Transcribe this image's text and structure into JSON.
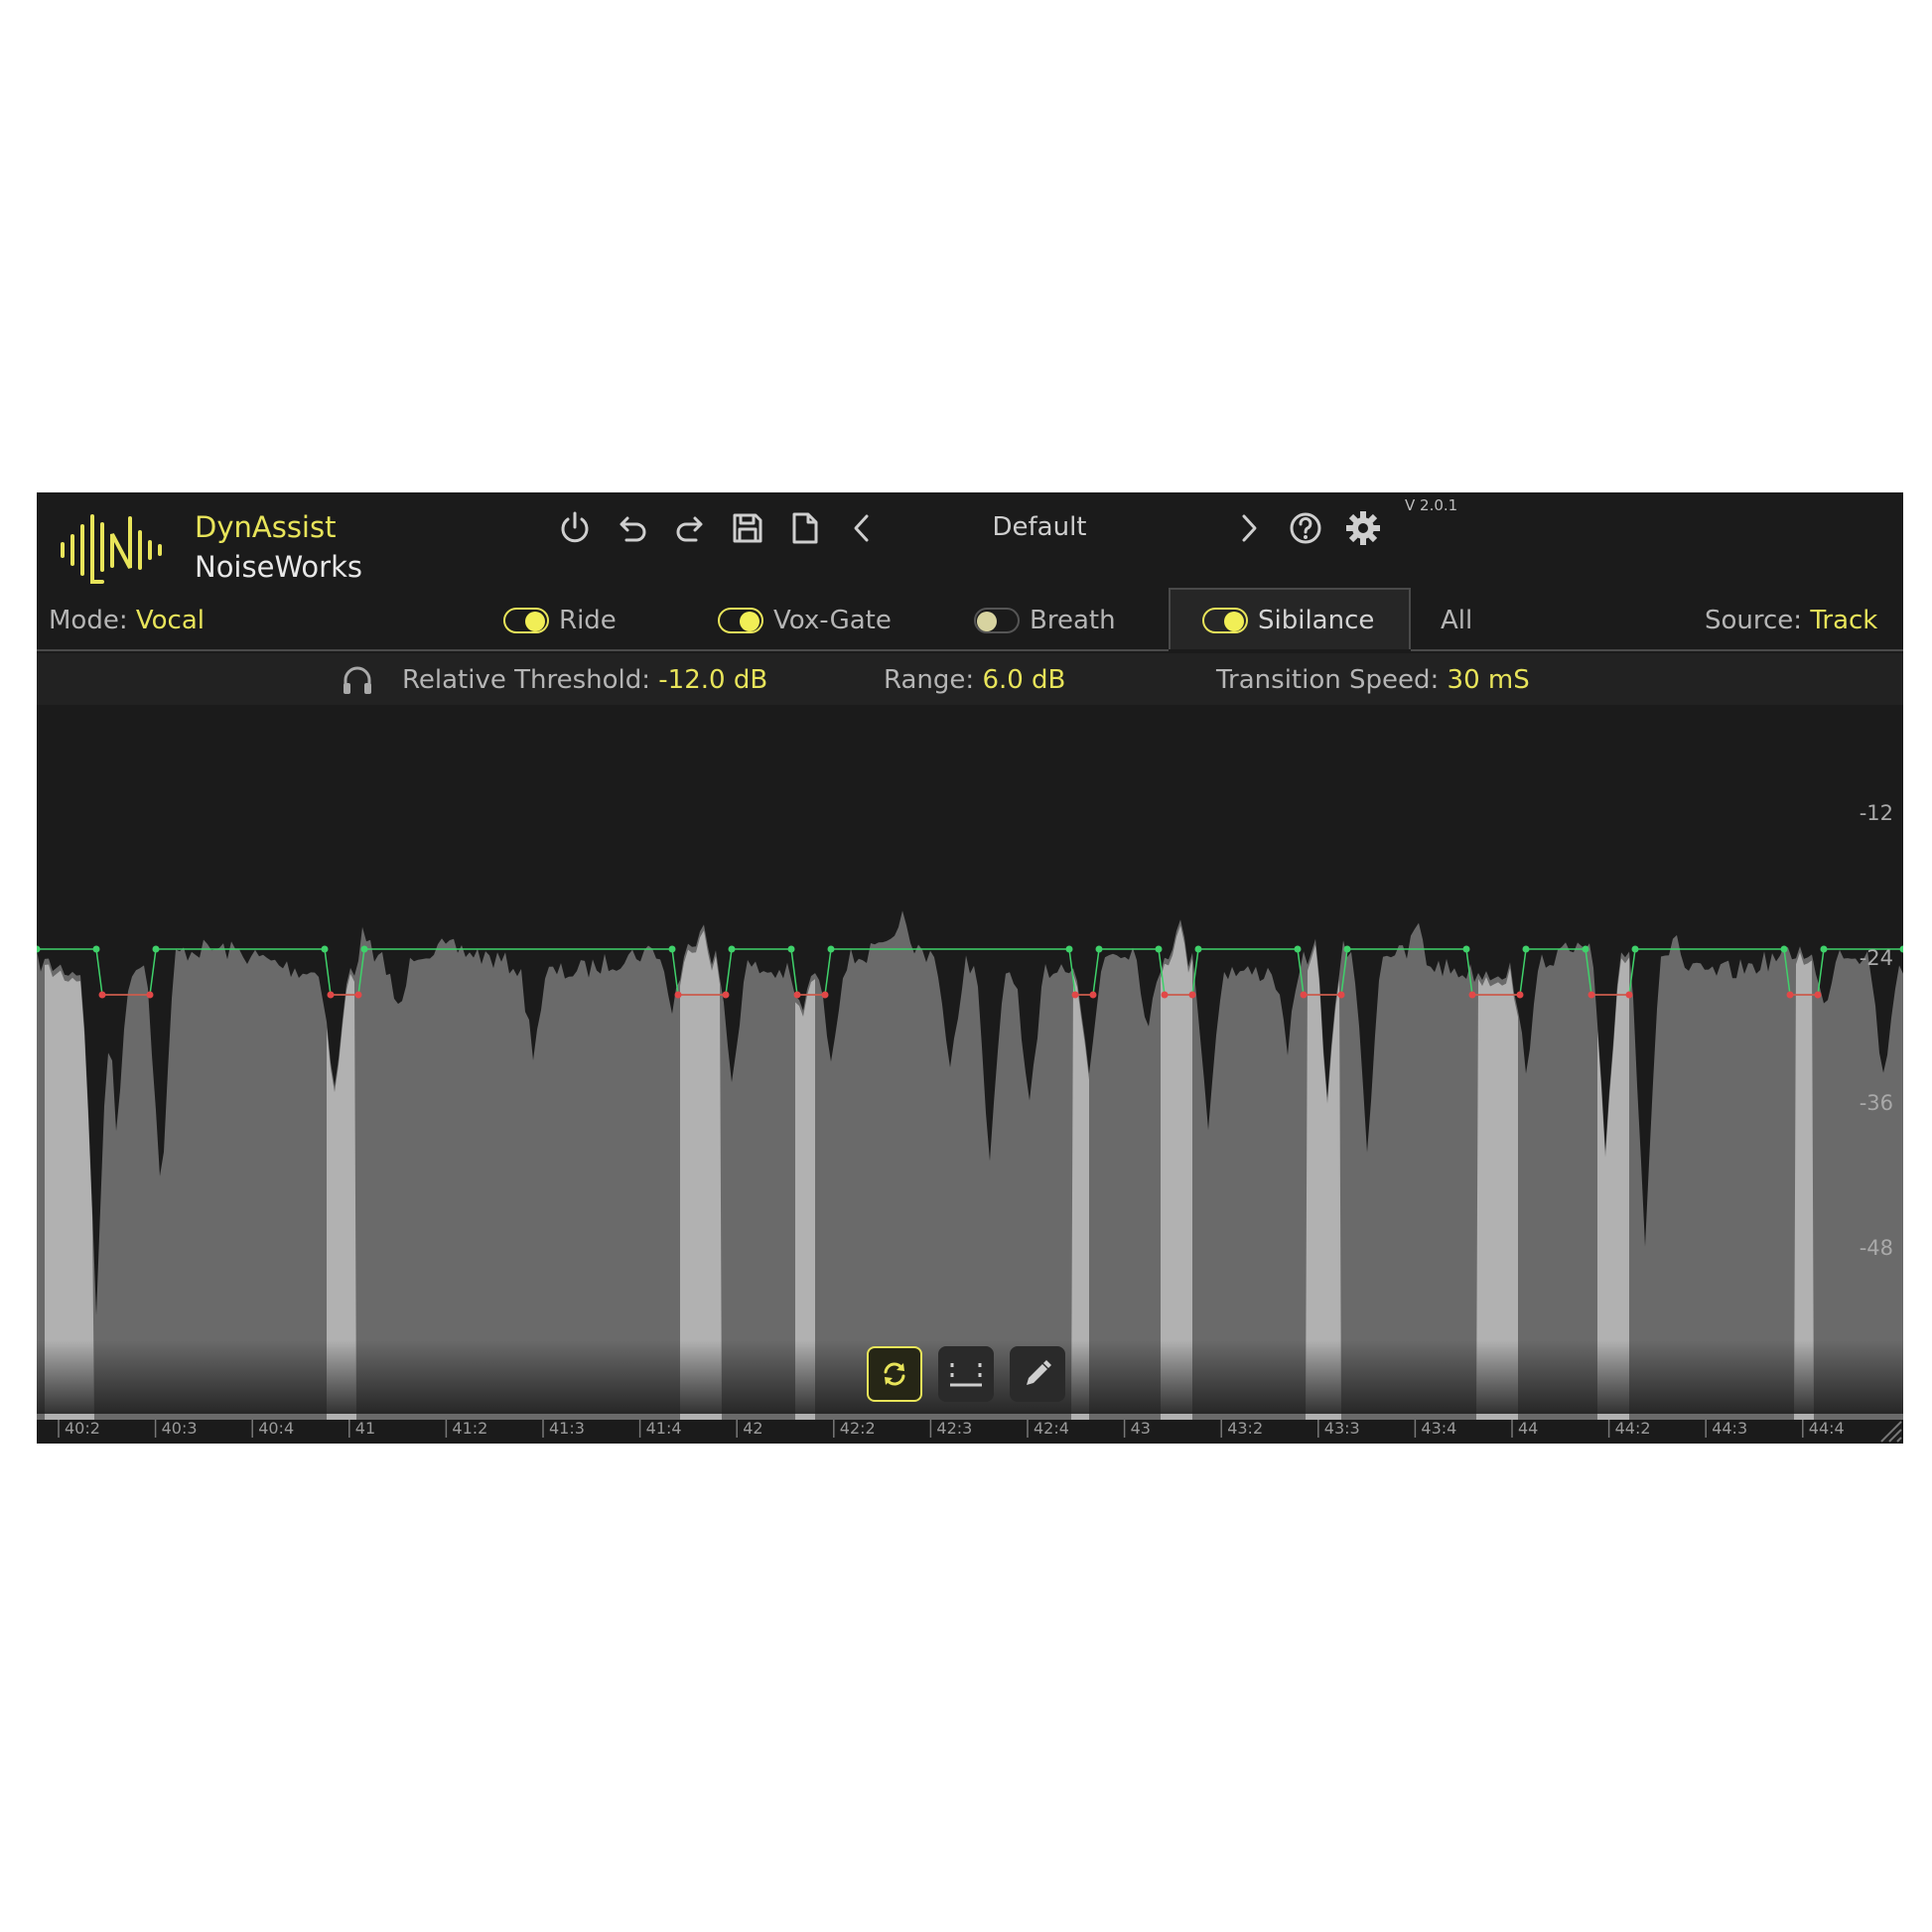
{
  "header": {
    "brand_name": "DynAssist",
    "company_name": "NoiseWorks",
    "preset_name": "Default",
    "version": "V 2.0.1",
    "toolbar_icons": [
      "power-icon",
      "undo-icon",
      "redo-icon",
      "save-icon",
      "new-file-icon",
      "chevron-left-icon",
      "chevron-right-icon",
      "help-icon",
      "gear-icon"
    ]
  },
  "mode_row": {
    "mode_label": "Mode:",
    "mode_value": "Vocal",
    "toggles": [
      {
        "label": "Ride",
        "on": true
      },
      {
        "label": "Vox-Gate",
        "on": true
      },
      {
        "label": "Breath",
        "on": false
      },
      {
        "label": "Sibilance",
        "on": true
      }
    ],
    "all_label": "All",
    "selected_tab": "Sibilance",
    "source_label": "Source:",
    "source_value": "Track"
  },
  "params": {
    "threshold_label": "Relative Threshold:",
    "threshold_value": "-12.0 dB",
    "range_label": "Range:",
    "range_value": "6.0 dB",
    "speed_label": "Transition Speed:",
    "speed_value": "30 mS"
  },
  "graph": {
    "db_labels": [
      "-12",
      "-24",
      "-36",
      "-48"
    ],
    "timeline_labels": [
      "40:2",
      "40:3",
      "40:4",
      "41",
      "41:2",
      "41:3",
      "41:4",
      "42",
      "42:2",
      "42:3",
      "42:4",
      "43",
      "43:2",
      "43:3",
      "43:4",
      "44",
      "44:2",
      "44:3",
      "44:4"
    ],
    "colors": {
      "waveform": "#6a6a6a",
      "sibilance_highlight": "#bdbdbd",
      "green_line": "#3fd16a",
      "red_line": "#e24848",
      "accent": "#e8e45a",
      "background": "#1b1b1b"
    }
  },
  "tools": [
    "refresh-icon",
    "grid-select-icon",
    "pencil-icon"
  ]
}
